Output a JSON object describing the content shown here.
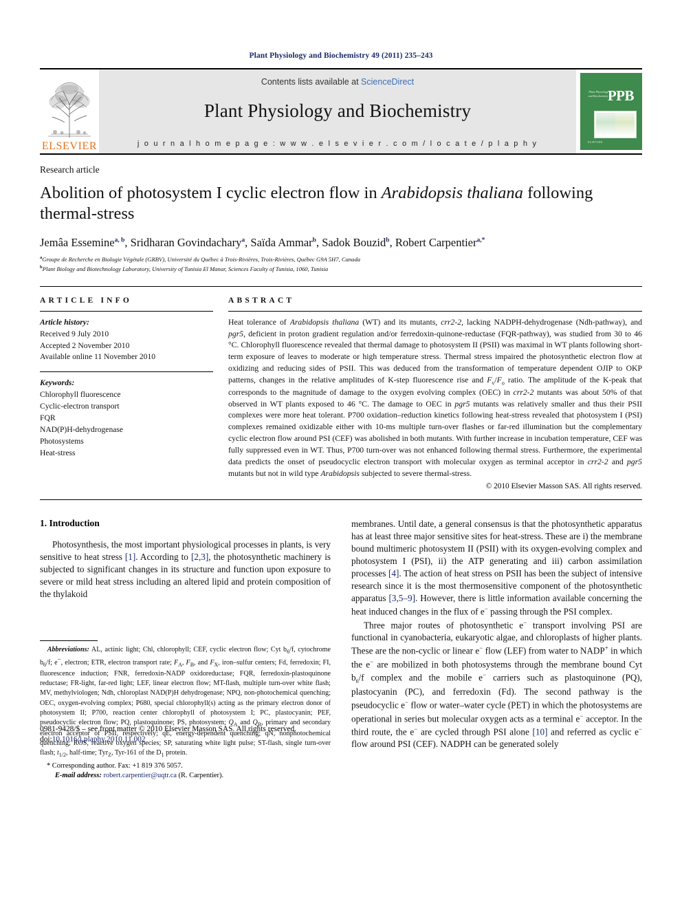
{
  "running_head": "Plant Physiology and Biochemistry 49 (2011) 235–243",
  "banner": {
    "contents_prefix": "Contents lists available at ",
    "sciencedirect": "ScienceDirect",
    "journal_title": "Plant Physiology and Biochemistry",
    "homepage": "j o u r n a l   h o m e p a g e :   w w w . e l s e v i e r . c o m / l o c a t e / p l a p h y",
    "publisher": "ELSEVIER",
    "cover_abbrev": "PPB",
    "cover_journal_name": "Plant Physiology and Biochemistry",
    "cover_publisher": "ELSEVIER",
    "accent_link_color": "#3b6fb6",
    "elsevier_orange": "#E8701A",
    "cover_green": "#3f8a4d"
  },
  "article": {
    "type": "Research article",
    "title_part1": "Abolition of photosystem I cyclic electron flow in ",
    "title_italic": "Arabidopsis thaliana",
    "title_part2": " following thermal-stress",
    "authors": [
      {
        "name": "Jemâa Essemine",
        "sup": "a, b"
      },
      {
        "name": "Sridharan Govindachary",
        "sup": "a"
      },
      {
        "name": "Saïda Ammar",
        "sup": "b"
      },
      {
        "name": "Sadok Bouzid",
        "sup": "b"
      },
      {
        "name": "Robert Carpentier",
        "sup": "a,*"
      }
    ],
    "affiliations": [
      {
        "marker": "a",
        "text": "Groupe de Recherche en Biologie Végétale (GRBV), Université du Québec à Trois-Rivières, Trois-Rivières, Québec G9A 5H7, Canada"
      },
      {
        "marker": "b",
        "text": "Plant Biology and Biotechnology Laboratory, University of Tunisia El Manar, Sciences Faculty of Tunisia, 1060, Tunisia"
      }
    ]
  },
  "article_info": {
    "heading": "ARTICLE INFO",
    "history_label": "Article history:",
    "history": [
      "Received 9 July 2010",
      "Accepted 2 November 2010",
      "Available online 11 November 2010"
    ],
    "keywords_label": "Keywords:",
    "keywords": [
      "Chlorophyll fluorescence",
      "Cyclic-electron transport",
      "FQR",
      "NAD(P)H-dehydrogenase",
      "Photosystems",
      "Heat-stress"
    ]
  },
  "abstract": {
    "heading": "ABSTRACT",
    "text": "Heat tolerance of Arabidopsis thaliana (WT) and its mutants, crr2-2, lacking NADPH-dehydrogenase (Ndh-pathway), and pgr5, deficient in proton gradient regulation and/or ferredoxin-quinone-reductase (FQR-pathway), was studied from 30 to 46 °C. Chlorophyll fluorescence revealed that thermal damage to photosystem II (PSII) was maximal in WT plants following short-term exposure of leaves to moderate or high temperature stress. Thermal stress impaired the photosynthetic electron flow at oxidizing and reducing sides of PSII. This was deduced from the transformation of temperature dependent OJIP to OKP patterns, changes in the relative amplitudes of K-step fluorescence rise and Fv/Fo ratio. The amplitude of the K-peak that corresponds to the magnitude of damage to the oxygen evolving complex (OEC) in crr2-2 mutants was about 50% of that observed in WT plants exposed to 46 °C. The damage to OEC in pgr5 mutants was relatively smaller and thus their PSII complexes were more heat tolerant. P700 oxidation–reduction kinetics following heat-stress revealed that photosystem I (PSI) complexes remained oxidizable either with 10-ms multiple turn-over flashes or far-red illumination but the complementary cyclic electron flow around PSI (CEF) was abolished in both mutants. With further increase in incubation temperature, CEF was fully suppressed even in WT. Thus, P700 turn-over was not enhanced following thermal stress. Furthermore, the experimental data predicts the onset of pseudocyclic electron transport with molecular oxygen as terminal acceptor in crr2-2 and pgr5 mutants but not in wild type Arabidopsis subjected to severe thermal-stress.",
    "copyright": "© 2010 Elsevier Masson SAS. All rights reserved."
  },
  "intro": {
    "heading": "1. Introduction",
    "p1": "Photosynthesis, the most important physiological processes in plants, is very sensitive to heat stress [1]. According to [2,3], the photosynthetic machinery is subjected to significant changes in its structure and function upon exposure to severe or mild heat stress including an altered lipid and protein composition of the thylakoid membranes. Until date, a general consensus is that the photosynthetic apparatus has at least three major sensitive sites for heat-stress. These are i) the membrane bound multimeric photosystem II (PSII) with its oxygen-evolving complex and photosystem I (PSI), ii) the ATP generating and iii) carbon assimilation processes [4]. The action of heat stress on PSII has been the subject of intensive research since it is the most thermosensitive component of the photosynthetic apparatus [3,5–9]. However, there is little information available concerning the heat induced changes in the flux of e− passing through the PSI complex.",
    "p2": "Three major routes of photosynthetic e− transport involving PSI are functional in cyanobacteria, eukaryotic algae, and chloroplasts of higher plants. These are the non-cyclic or linear e− flow (LEF) from water to NADP+ in which the e− are mobilized in both photosystems through the membrane bound Cyt b6/f complex and the mobile e− carriers such as plastoquinone (PQ), plastocyanin (PC), and ferredoxin (Fd). The second pathway is the pseudocyclic e− flow or water–water cycle (PET) in which the photosystems are operational in series but molecular oxygen acts as a terminal e− acceptor. In the third route, the e− are cycled through PSI alone [10] and referred as cyclic e− flow around PSI (CEF). NADPH can be generated solely"
  },
  "footnote": {
    "abbrev_label": "Abbreviations:",
    "abbrev_text": "AL, actinic light; Chl, chlorophyll; CEF, cyclic electron flow; Cyt b6/f, cytochrome b6/f; e−, electron; ETR, electron transport rate; FA, FB, and FX, iron–sulfur centers; Fd, ferredoxin; FI, fluorescence induction; FNR, ferredoxin-NADP oxidoreductase; FQR, ferredoxin-plastoquinone reductase; FR-light, far-red light; LEF, linear electron flow; MT-flash, multiple turn-over white flash; MV, methylviologen; Ndh, chloroplast NAD(P)H dehydrogenase; NPQ, non-photochemical quenching; OEC, oxygen-evolving complex; P680, special chlorophyll(s) acting as the primary electron donor of photosystem II; P700, reaction center chlorophyll of photosystem I; PC, plastocyanin; PEF, pseudocyclic electron flow; PQ, plastoquinone; PS, photosystem; QA and QB, primary and secondary electron acceptor of PSII, respectively; qE, energy-dependent quenching; qN, nonphotochemical quenching; ROS, reactive oxygen species; SP, saturating white light pulse; ST-flash, single turn-over flash; t1/2, half-time; TyrZ, Tyr-161 of the D1 protein.",
    "corresponding": "* Corresponding author. Fax: +1 819 376 5057.",
    "email_label": "E-mail address:",
    "email": "robert.carpentier@uqtr.ca",
    "email_suffix": " (R. Carpentier)."
  },
  "issn": {
    "line1": "0981-9428/$ – see front matter © 2010 Elsevier Masson SAS. All rights reserved.",
    "doi_label": "doi:",
    "doi": "10.1016/j.plaphy.2010.11.002"
  }
}
